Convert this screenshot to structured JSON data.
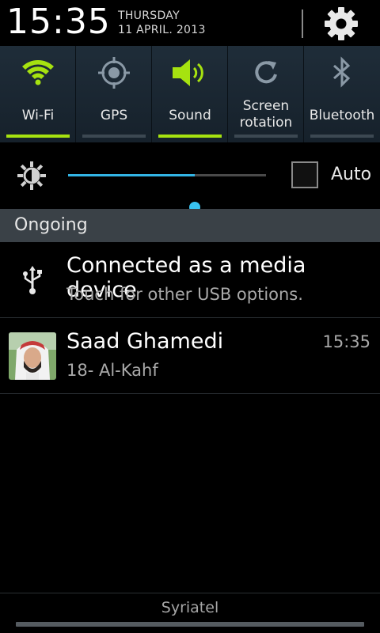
{
  "header": {
    "time": "15:35",
    "day": "THURSDAY",
    "date": "11 APRIL. 2013",
    "settings_icon": "gear-icon"
  },
  "toggles": [
    {
      "label": "Wi-Fi",
      "icon": "wifi-icon",
      "on": true
    },
    {
      "label": "GPS",
      "icon": "gps-icon",
      "on": false
    },
    {
      "label": "Sound",
      "icon": "sound-icon",
      "on": true
    },
    {
      "label_line1": "Screen",
      "label_line2": "rotation",
      "icon": "rotation-icon",
      "on": false
    },
    {
      "label": "Bluetooth",
      "icon": "bluetooth-icon",
      "on": false
    }
  ],
  "brightness": {
    "level_percent": 64,
    "auto_label": "Auto",
    "auto_checked": false
  },
  "section": {
    "ongoing_label": "Ongoing"
  },
  "notifications": [
    {
      "title": "Connected as a media device",
      "subtitle": "Touch for other USB options.",
      "icon": "usb-icon"
    },
    {
      "title": "Saad Ghamedi",
      "subtitle": "18- Al-Kahf",
      "time": "15:35",
      "icon": "avatar"
    }
  ],
  "footer": {
    "carrier": "Syriatel"
  },
  "colors": {
    "accent_on": "#a6e210",
    "slider": "#33b5e5",
    "toggle_bg": "#1b2732"
  }
}
